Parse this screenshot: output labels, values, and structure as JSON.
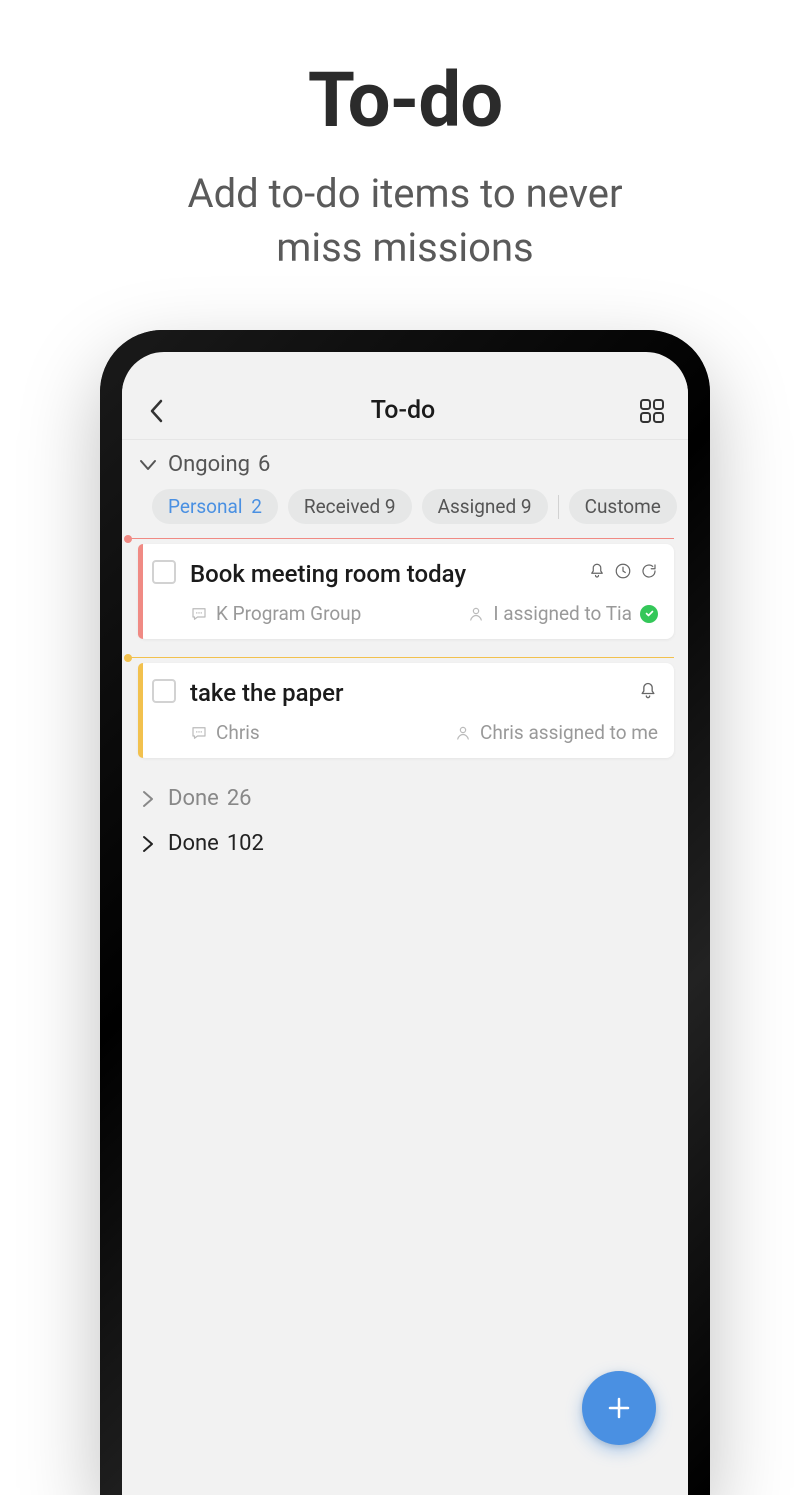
{
  "promo": {
    "title": "To-do",
    "subtitle_line1": "Add to-do items to never",
    "subtitle_line2": "miss missions"
  },
  "header": {
    "title": "To-do"
  },
  "ongoing": {
    "label": "Ongoing",
    "count": "6"
  },
  "filters": [
    {
      "label": "Personal",
      "count": "2",
      "active": true
    },
    {
      "label": "Received",
      "count": "9",
      "active": false
    },
    {
      "label": "Assigned",
      "count": "9",
      "active": false
    },
    {
      "label": "Custome",
      "count": "",
      "active": false
    }
  ],
  "cards": [
    {
      "accent_color": "#f08a84",
      "title": "Book meeting room today",
      "source": "K Program Group",
      "assignee": "I assigned to Tia",
      "has_bell": true,
      "has_clock": true,
      "has_refresh": true,
      "has_check_badge": true
    },
    {
      "accent_color": "#f2c14e",
      "title": "take the paper",
      "source": "Chris",
      "assignee": "Chris assigned to me",
      "has_bell": true,
      "has_clock": false,
      "has_refresh": false,
      "has_check_badge": false
    }
  ],
  "done_sections": [
    {
      "label": "Done",
      "count": "26",
      "style": "dim"
    },
    {
      "label": "Done",
      "count": "102",
      "style": "dark"
    }
  ]
}
